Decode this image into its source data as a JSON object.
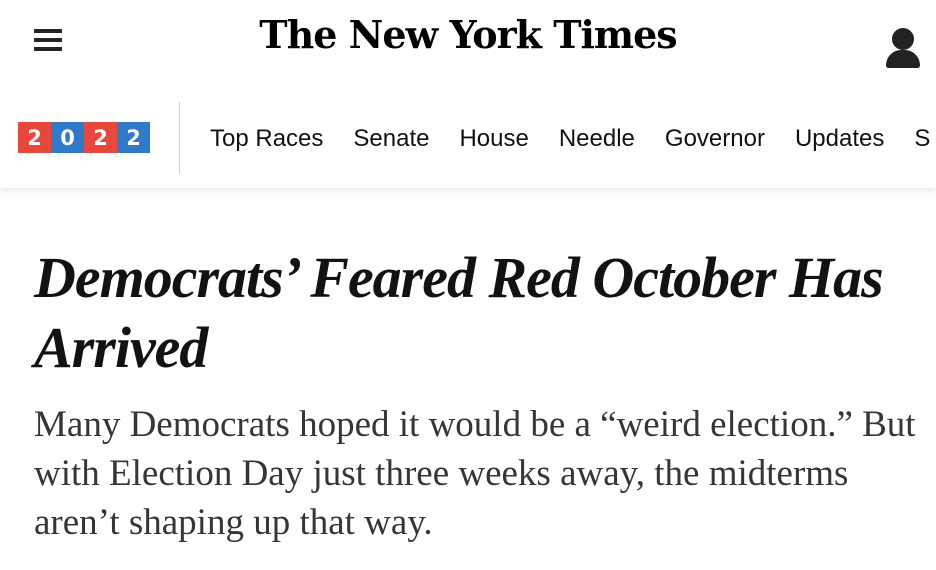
{
  "header": {
    "logo_text": "The New York Times",
    "menu_icon": "hamburger-menu-icon",
    "account_icon": "user-account-icon"
  },
  "nav": {
    "badge": {
      "digits": [
        "2",
        "0",
        "2",
        "2"
      ],
      "colors": [
        "#e8483c",
        "#2f7ac9",
        "#e8483c",
        "#2f7ac9"
      ]
    },
    "items": [
      "Top Races",
      "Senate",
      "House",
      "Needle",
      "Governor",
      "Updates",
      "S"
    ]
  },
  "article": {
    "headline": "Democrats’ Feared Red October Has Arrived",
    "summary": "Many Democrats hoped it would be a “weird election.” But with Election Day just three weeks away, the midterms aren’t shaping up that way."
  }
}
